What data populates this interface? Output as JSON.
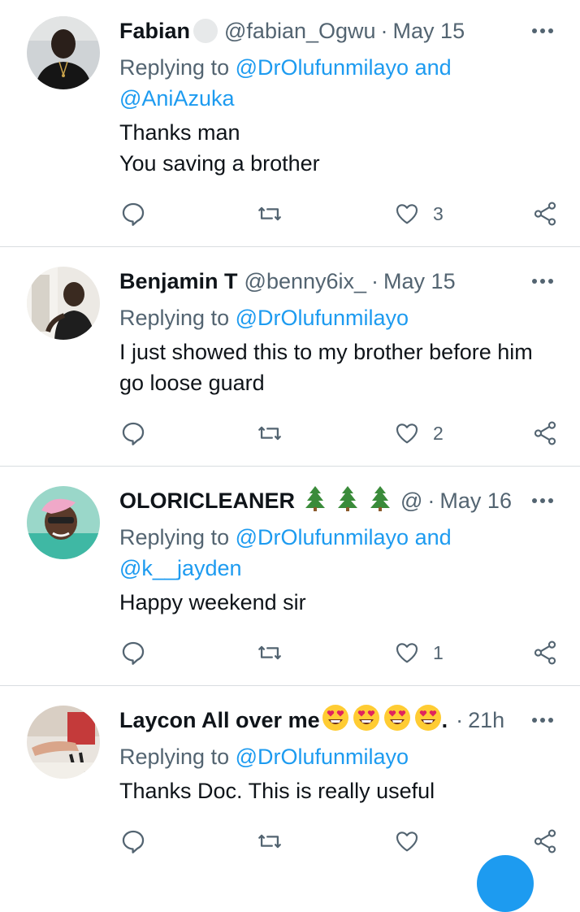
{
  "tweets": [
    {
      "name": "Fabian",
      "handle": "@fabian_Ogwu",
      "dot": "·",
      "time": "May 15",
      "replying_prefix": "Replying to",
      "replying_to_1": "@DrOlufunmilayo",
      "replying_and": "and",
      "replying_to_2": "@AniAzuka",
      "text_lines": [
        "Thanks man",
        "You saving a brother"
      ],
      "likes": "3",
      "icons": [
        "reply-icon",
        "retweet-icon",
        "like-icon",
        "share-icon"
      ]
    },
    {
      "name": "Benjamin T",
      "handle": "@benny6ix_",
      "dot": "·",
      "time": "May 15",
      "replying_prefix": "Replying to",
      "replying_to_1": "@DrOlufunmilayo",
      "text_lines": [
        "I just showed this to my brother before him",
        "go loose guard"
      ],
      "likes": "2",
      "icons": [
        "reply-icon",
        "retweet-icon",
        "like-icon",
        "share-icon"
      ]
    },
    {
      "name": "OLORICLEANER",
      "name_emoji": [
        "evergreen-tree",
        "evergreen-tree",
        "evergreen-tree"
      ],
      "handle": "@",
      "dot": "·",
      "time": "May 16",
      "replying_prefix": "Replying to",
      "replying_to_1": "@DrOlufunmilayo",
      "replying_and": "and",
      "replying_to_2": "@k__jayden",
      "text_lines": [
        "Happy weekend sir"
      ],
      "likes": "1",
      "icons": [
        "reply-icon",
        "retweet-icon",
        "like-icon",
        "share-icon"
      ]
    },
    {
      "name": "Laycon All over me",
      "name_emoji": [
        "heart-eyes",
        "heart-eyes",
        "heart-eyes",
        "heart-eyes"
      ],
      "name_suffix": ".",
      "dot": "·",
      "time": "21h",
      "replying_prefix": "Replying to",
      "replying_to_1": "@DrOlufunmilayo",
      "text_lines": [
        "Thanks Doc. This is really useful"
      ],
      "icons": [
        "reply-icon",
        "retweet-icon",
        "like-icon",
        "share-icon"
      ]
    }
  ],
  "colors": {
    "link": "#1d9bf0",
    "secondary_text": "#536471",
    "primary_text": "#0f1419",
    "divider": "#d9dde0"
  }
}
